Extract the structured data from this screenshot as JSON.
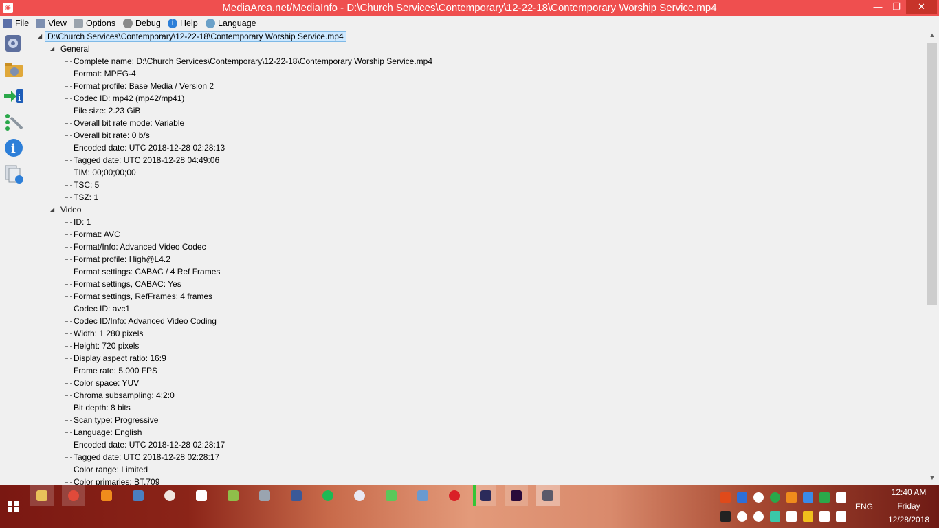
{
  "window": {
    "title": "MediaArea.net/MediaInfo - D:\\Church Services\\Contemporary\\12-22-18\\Contemporary Worship Service.mp4",
    "min_glyph": "—",
    "max_glyph": "❐",
    "close_glyph": "✕"
  },
  "menu": [
    "File",
    "View",
    "Options",
    "Debug",
    "Help",
    "Language"
  ],
  "tree": {
    "root": "D:\\Church Services\\Contemporary\\12-22-18\\Contemporary Worship Service.mp4",
    "general_label": "General",
    "general_items": [
      "Complete name: D:\\Church Services\\Contemporary\\12-22-18\\Contemporary Worship Service.mp4",
      "Format: MPEG-4",
      "Format profile: Base Media / Version 2",
      "Codec ID: mp42 (mp42/mp41)",
      "File size: 2.23 GiB",
      "Overall bit rate mode: Variable",
      "Overall bit rate: 0 b/s",
      "Encoded date: UTC 2018-12-28 02:28:13",
      "Tagged date: UTC 2018-12-28 04:49:06",
      "TIM: 00;00;00;00",
      "TSC: 5",
      "TSZ: 1"
    ],
    "video_label": "Video",
    "video_items": [
      "ID: 1",
      "Format: AVC",
      "Format/Info: Advanced Video Codec",
      "Format profile: High@L4.2",
      "Format settings: CABAC / 4 Ref Frames",
      "Format settings, CABAC: Yes",
      "Format settings, RefFrames: 4 frames",
      "Codec ID: avc1",
      "Codec ID/Info: Advanced Video Coding",
      "Width: 1 280 pixels",
      "Height: 720 pixels",
      "Display aspect ratio: 16:9",
      "Frame rate: 5.000 FPS",
      "Color space: YUV",
      "Chroma subsampling: 4:2:0",
      "Bit depth: 8 bits",
      "Scan type: Progressive",
      "Language: English",
      "Encoded date: UTC 2018-12-28 02:28:17",
      "Tagged date: UTC 2018-12-28 02:28:17",
      "Color range: Limited",
      "Color primaries: BT.709"
    ]
  },
  "taskbar": {
    "language": "ENG",
    "time": "12:40 AM",
    "day": "Friday",
    "date": "12/28/2018"
  },
  "colors": {
    "titlebar": "#ef4f4f",
    "selection": "#cce8ff"
  }
}
